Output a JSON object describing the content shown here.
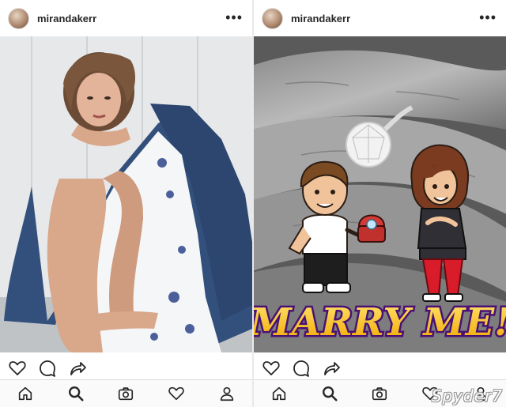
{
  "posts": [
    {
      "username": "mirandakerr",
      "more_label": "•••",
      "photo_icon": "portrait-photo"
    },
    {
      "username": "mirandakerr",
      "more_label": "•••",
      "photo_icon": "ring-bitmoji-photo",
      "overlay_text": "MARRY ME!"
    }
  ],
  "actions": [
    "heart-icon",
    "comment-icon",
    "share-icon"
  ],
  "tabbar": [
    "home-icon",
    "search-icon",
    "camera-icon",
    "activity-heart-icon",
    "profile-icon"
  ],
  "watermark": "Spyder7",
  "colors": {
    "text": "#262626",
    "tabbar_bg": "#fafafa",
    "border": "#dbdbdb",
    "marry_yellow": "#f5c400",
    "marry_purple": "#5a1a8a"
  }
}
